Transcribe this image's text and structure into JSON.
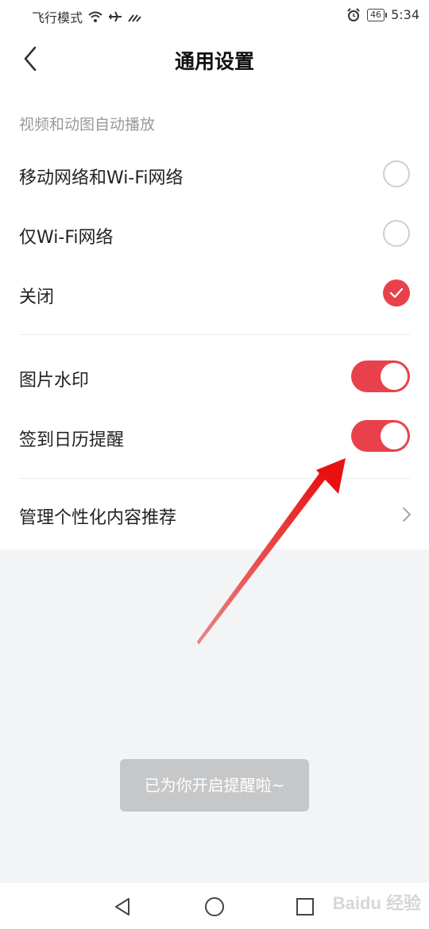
{
  "status_bar": {
    "carrier": "飞行模式",
    "time": "5:34",
    "battery": "46"
  },
  "header": {
    "title": "通用设置",
    "back_icon": "chevron-left-icon"
  },
  "autoplay_section": {
    "label": "视频和动图自动播放",
    "options": [
      {
        "label": "移动网络和Wi-Fi网络",
        "checked": false
      },
      {
        "label": "仅Wi-Fi网络",
        "checked": false
      },
      {
        "label": "关闭",
        "checked": true
      }
    ]
  },
  "toggles": [
    {
      "label": "图片水印",
      "on": true
    },
    {
      "label": "签到日历提醒",
      "on": true
    }
  ],
  "personalization": {
    "label": "管理个性化内容推荐"
  },
  "toast": {
    "text": "已为你开启提醒啦~"
  },
  "colors": {
    "accent": "#e8414b",
    "background": "#f3f4f6"
  },
  "watermark": {
    "text": "Baidu 经验"
  }
}
